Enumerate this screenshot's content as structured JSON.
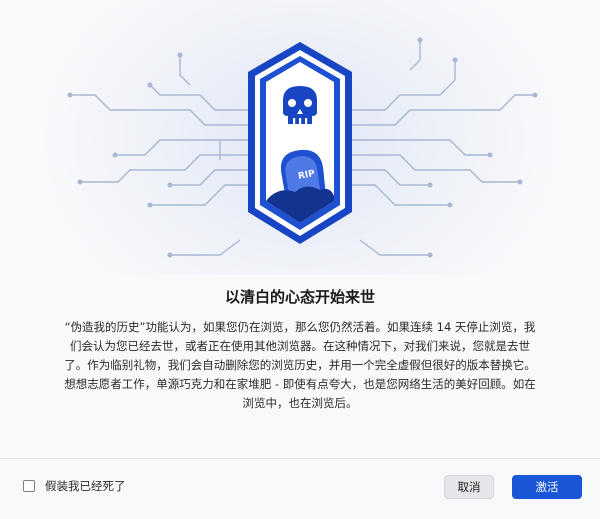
{
  "hero": {
    "badge_text": "RIP",
    "colors": {
      "shield": "#1745c4",
      "shield_light": "#2f62e2",
      "circuit": "#9fb0cf",
      "background_glow": "#dfe6f7"
    },
    "icons": [
      "skull-icon",
      "tombstone-icon",
      "circuit-lines"
    ]
  },
  "content": {
    "title": "以清白的心态开始来世",
    "description": "“伪造我的历史”功能认为，如果您仍在浏览，那么您仍然活着。如果连续 14 天停止浏览，我们会认为您已经去世，或者正在使用其他浏览器。在这种情况下，对我们来说，您就是去世了。作为临别礼物，我们会自动删除您的浏览历史，并用一个完全虚假但很好的版本替换它。想想志愿者工作，单源巧克力和在家堆肥 - 即使有点夸大，也是您网络生活的美好回顾。如在浏览中，也在浏览后。"
  },
  "footer": {
    "checkbox_label": "假装我已经死了",
    "checkbox_checked": false,
    "cancel_label": "取消",
    "activate_label": "激活",
    "accent_color": "#1a56d8"
  }
}
